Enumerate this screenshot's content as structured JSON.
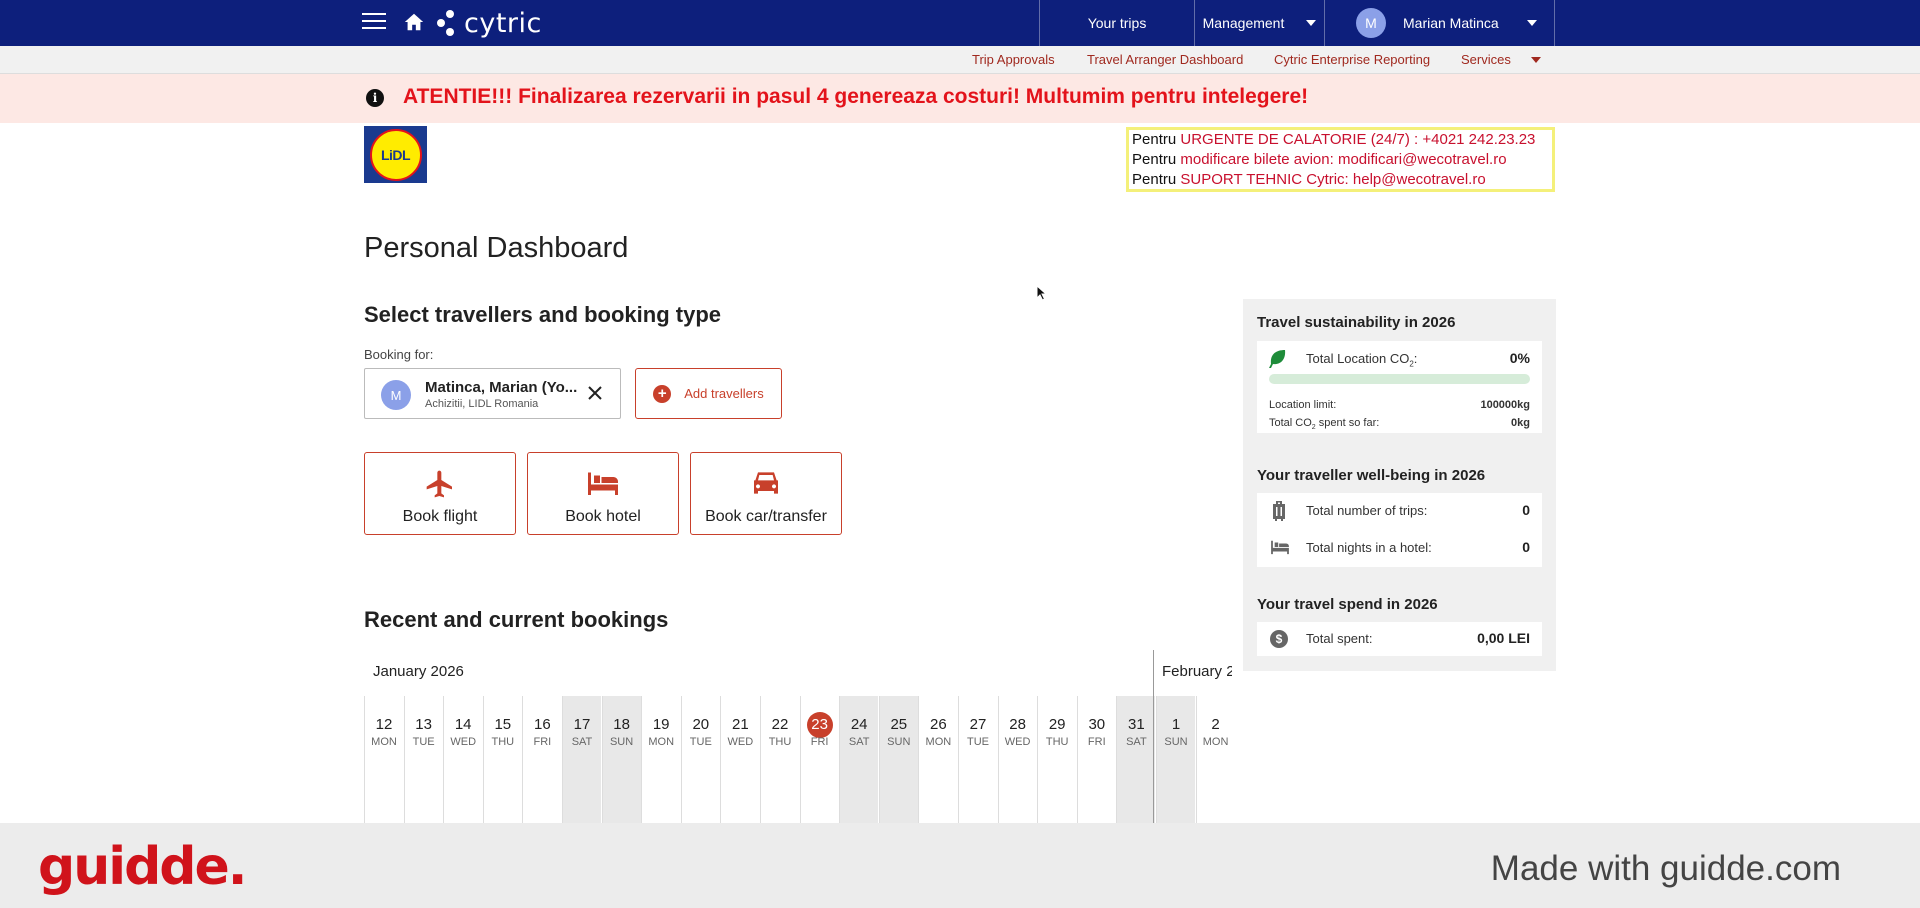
{
  "topbar": {
    "brand": "cytric",
    "your_trips": "Your trips",
    "management": "Management",
    "user_initial": "M",
    "user_name": "Marian Matinca"
  },
  "subnav": {
    "items": [
      "Trip Approvals",
      "Travel Arranger Dashboard",
      "Cytric Enterprise Reporting",
      "Services"
    ]
  },
  "alert": {
    "message": "ATENTIE!!! Finalizarea rezervarii in pasul 4 genereaza costuri! Multumim pentru intelegere!"
  },
  "logo": {
    "text": "LiDL"
  },
  "contact": {
    "line1_prefix": "Pentru ",
    "line1_red": "URGENTE DE CALATORIE (24/7) : +4021 242.23.23",
    "line2_prefix": "Pentru ",
    "line2_red": "modificare bilete avion:  modificari@wecotravel.ro",
    "line3_prefix": "Pentru ",
    "line3_red": "SUPORT TEHNIC Cytric:  help@wecotravel.ro"
  },
  "main": {
    "page_title": "Personal Dashboard",
    "select_title": "Select travellers and booking type",
    "booking_for": "Booking for:",
    "traveller": {
      "initial": "M",
      "name": "Matinca, Marian (Yo...",
      "org": "Achizitii, LIDL Romania"
    },
    "add_travellers": "Add travellers",
    "book_flight": "Book flight",
    "book_hotel": "Book hotel",
    "book_car": "Book car/transfer",
    "recent_title": "Recent and current bookings"
  },
  "calendar": {
    "month1": "January 2026",
    "month2": "February 2",
    "days": [
      {
        "num": "12",
        "dow": "MON"
      },
      {
        "num": "13",
        "dow": "TUE"
      },
      {
        "num": "14",
        "dow": "WED"
      },
      {
        "num": "15",
        "dow": "THU"
      },
      {
        "num": "16",
        "dow": "FRI"
      },
      {
        "num": "17",
        "dow": "SAT"
      },
      {
        "num": "18",
        "dow": "SUN"
      },
      {
        "num": "19",
        "dow": "MON"
      },
      {
        "num": "20",
        "dow": "TUE"
      },
      {
        "num": "21",
        "dow": "WED"
      },
      {
        "num": "22",
        "dow": "THU"
      },
      {
        "num": "23",
        "dow": "FRI"
      },
      {
        "num": "24",
        "dow": "SAT"
      },
      {
        "num": "25",
        "dow": "SUN"
      },
      {
        "num": "26",
        "dow": "MON"
      },
      {
        "num": "27",
        "dow": "TUE"
      },
      {
        "num": "28",
        "dow": "WED"
      },
      {
        "num": "29",
        "dow": "THU"
      },
      {
        "num": "30",
        "dow": "FRI"
      },
      {
        "num": "31",
        "dow": "SAT"
      },
      {
        "num": "1",
        "dow": "SUN"
      },
      {
        "num": "2",
        "dow": "MON"
      }
    ],
    "today": "23"
  },
  "panel": {
    "sustain_title": "Travel sustainability in 2026",
    "co2_label": "Total Location CO",
    "co2_sub": "2",
    "co2_colon": ":",
    "co2_value": "0%",
    "co2_progress": 0,
    "limit_label": "Location limit:",
    "limit_value": "100000kg",
    "spent_label_a": "Total CO",
    "spent_label_sub": "2",
    "spent_label_b": " spent so far:",
    "spent_value": "0kg",
    "wellbeing_title": "Your traveller well-being in 2026",
    "trips_label": "Total number of trips:",
    "trips_value": "0",
    "nights_label": "Total nights in a hotel:",
    "nights_value": "0",
    "spend_title": "Your travel spend in 2026",
    "total_spent_label": "Total spent:",
    "total_spent_value": "0,00 LEI"
  },
  "footer": {
    "logo": "guidde.",
    "made_with": "Made with guidde.com"
  },
  "colors": {
    "navbar": "#0d1f7c",
    "accent": "#c8402b",
    "alert_bg": "#fde8e4",
    "alert_text": "#e3131b"
  }
}
